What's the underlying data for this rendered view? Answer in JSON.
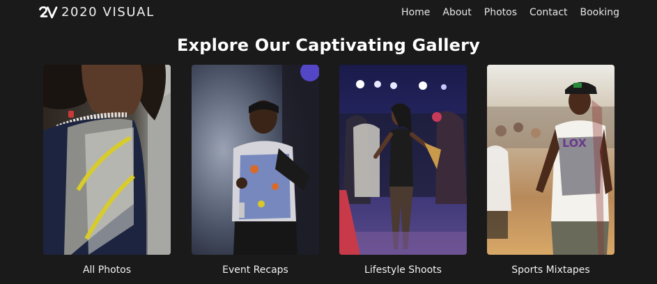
{
  "brand": {
    "logo_text": "2V",
    "name": "2020 VISUAL"
  },
  "nav": {
    "items": [
      "Home",
      "About",
      "Photos",
      "Contact",
      "Booking"
    ]
  },
  "gallery": {
    "title": "Explore Our Captivating Gallery",
    "cards": [
      {
        "label": "All Photos"
      },
      {
        "label": "Event Recaps"
      },
      {
        "label": "Lifestyle Shoots"
      },
      {
        "label": "Sports Mixtapes"
      }
    ]
  },
  "colors": {
    "background": "#1a1a1a",
    "text": "#ffffff"
  }
}
